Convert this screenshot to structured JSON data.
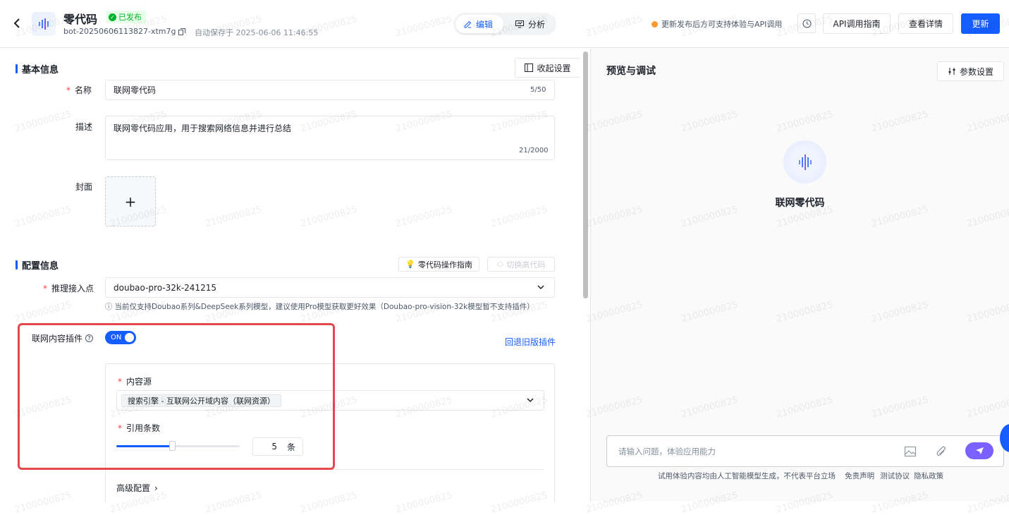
{
  "header": {
    "title": "零代码",
    "status": "已发布",
    "bot_id": "bot-20250606113827-xtm7g",
    "autosave": "自动保存于 2025-06-06 11:46:55",
    "tabs": [
      {
        "label": "编辑",
        "active": true
      },
      {
        "label": "分析",
        "active": false
      }
    ],
    "update_tip": "更新发布后方可支持体验与API调用",
    "api_guide": "API调用指南",
    "view_details": "查看详情",
    "update": "更新"
  },
  "basic_info": {
    "section_title": "基本信息",
    "collapse_settings": "收起设置",
    "name_label": "名称",
    "name_value": "联网零代码",
    "name_count": "5/50",
    "desc_label": "描述",
    "desc_value": "联网零代码应用，用于搜索网络信息并进行总结",
    "desc_count": "21/2000",
    "cover_label": "封面",
    "cover_add": "+"
  },
  "config": {
    "section_title": "配置信息",
    "guide_button": "零代码操作指南",
    "switch_button": "切换高代码",
    "endpoint_label": "推理接入点",
    "endpoint_value": "doubao-pro-32k-241215",
    "hint": "当前仅支持Doubao系列&DeepSeek系列模型，建议使用Pro模型获取更好效果（Doubao-pro-vision-32k模型暂不支持插件）",
    "plugin_label": "联网内容插件",
    "plugin_toggle": "ON",
    "rollback_link": "回退旧版插件",
    "content_source_label": "内容源",
    "content_source_tag": "搜索引擎 - 互联网公开域内容（联网资源）",
    "citation_label": "引用条数",
    "citation_value": "5",
    "citation_unit": "条",
    "citation_slider_fraction": 0.45,
    "advanced": "高级配置"
  },
  "preview": {
    "title": "预览与调试",
    "param_settings": "参数设置",
    "bot_name": "联网零代码",
    "input_placeholder": "请输入问题，体验应用能力",
    "disclaimer": "试用体验内容均由人工智能模型生成，不代表平台立场",
    "links": [
      "免责声明",
      "测试协议",
      "隐私政策"
    ]
  },
  "watermark": "2100000825",
  "colors": {
    "primary": "#165dff",
    "success": "#00b42a",
    "warning": "#ff9a2e",
    "highlight": "#e5484d",
    "send": "#7b61ff"
  }
}
